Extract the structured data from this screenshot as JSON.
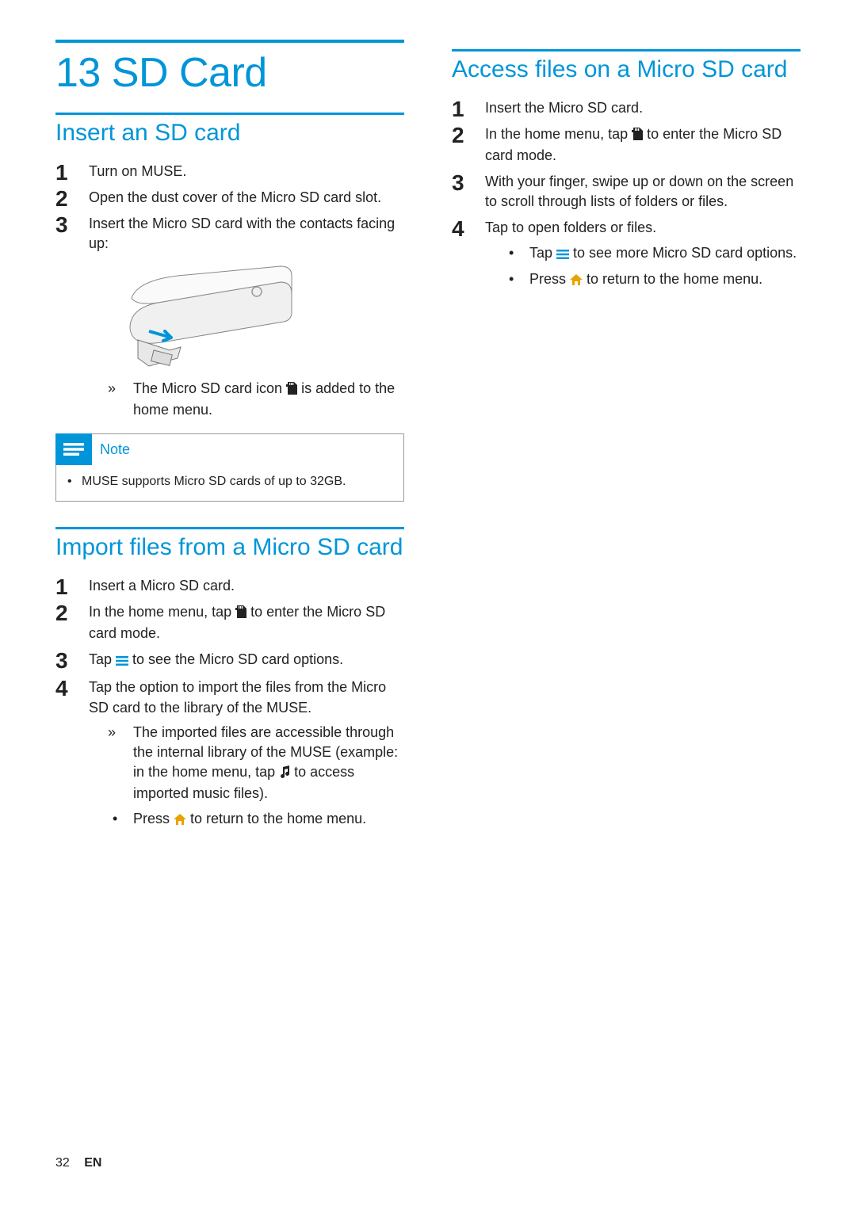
{
  "chapter": {
    "number": "13",
    "title": "SD Card"
  },
  "footer": {
    "page": "32",
    "lang": "EN"
  },
  "sec_insert": {
    "title": "Insert an SD card",
    "steps": {
      "s1": "Turn on MUSE.",
      "s2": "Open the dust cover of the Micro SD card slot.",
      "s3": "Insert the Micro SD card with the contacts facing up:",
      "s3_sub_a_pre": "The Micro SD card icon ",
      "s3_sub_a_post": " is added to the home menu."
    },
    "note_label": "Note",
    "note_body": "MUSE supports Micro SD cards of up to 32GB."
  },
  "sec_import": {
    "title": "Import files from a Micro SD card",
    "steps": {
      "s1": "Insert a Micro SD card.",
      "s2_pre": "In the home menu, tap ",
      "s2_post": " to enter the Micro SD card mode.",
      "s3_pre": "Tap ",
      "s3_post": " to see the Micro SD card options.",
      "s4": "Tap the option to import the files from the Micro SD card to the library of the MUSE.",
      "s4_sub_a_pre": "The imported files are accessible through the internal library of the MUSE (example: in the home menu, tap ",
      "s4_sub_a_post": " to access imported music files).",
      "s4_sub_b_pre": "Press ",
      "s4_sub_b_post": " to return to the home menu."
    }
  },
  "sec_access": {
    "title": "Access files on a Micro SD card",
    "steps": {
      "s1": "Insert the Micro SD card.",
      "s2_pre": "In the home menu, tap ",
      "s2_post": " to enter the Micro SD card mode.",
      "s3": "With your finger, swipe up or down on the screen to scroll through lists of folders or files.",
      "s4": "Tap to open folders or files.",
      "s4_sub_a_pre": "Tap ",
      "s4_sub_a_post": " to see more Micro SD card options.",
      "s4_sub_b_pre": "Press ",
      "s4_sub_b_post": " to return to the home menu."
    }
  }
}
